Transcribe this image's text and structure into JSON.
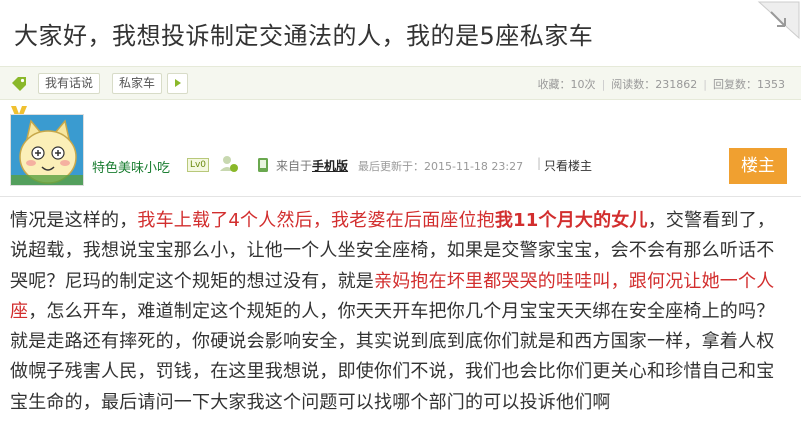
{
  "post": {
    "title": "大家好，我想投诉制定交通法的人，我的是5座私家车"
  },
  "meta": {
    "tags": [
      "我有话说",
      "私家车"
    ],
    "stats": {
      "favorites": "收藏：10次",
      "views": "阅读数：231862",
      "replies": "回复数：1353"
    }
  },
  "author": {
    "name": "特色美味小吃",
    "level_badge": "Lv0",
    "source_prefix": "来自于",
    "source_link": "手机版",
    "last_update": "最后更新于：2015-11-18 23:27",
    "only_op": "只看楼主",
    "op_label": "楼主"
  },
  "body": {
    "s1": "情况是这样的，",
    "s2": "我车上载了4个人然后，我老婆在后面座位抱",
    "s3": "我11个月大的女儿",
    "s4": "，交警看到了，说超载，我想说宝宝那么小，让他一个人坐安全座椅，如果是交警家宝宝，会不会有那么听话不哭呢？尼玛的制定这个规矩的想过没有，就是",
    "s5": "亲妈抱在坏里都哭哭的哇哇叫，跟何况让她一个人座",
    "s6": "，怎么开车，难道制定这个规矩的人，你天天开车把你几个月宝宝天天绑在安全座椅上的吗？就是走路还有摔死的，你硬说会影响安全，其实说到底到底你们就是和西方国家一样，拿着人权做幌子残害人民，罚钱，在这里我想说，即使你们不说，我们也会比你们更关心和珍惜自己和宝宝生命的，最后请问一下大家我这个问题可以找哪个部门的可以投诉他们啊"
  },
  "colors": {
    "accent_green": "#8ab82a",
    "username_green": "#1b7e32",
    "highlight_red": "#d22e2e",
    "op_orange": "#f0a030"
  },
  "icons": [
    "corner-fold-icon",
    "tag-icon",
    "arrow-right-icon",
    "medal-icon",
    "user-avatar",
    "mobile-icon"
  ]
}
